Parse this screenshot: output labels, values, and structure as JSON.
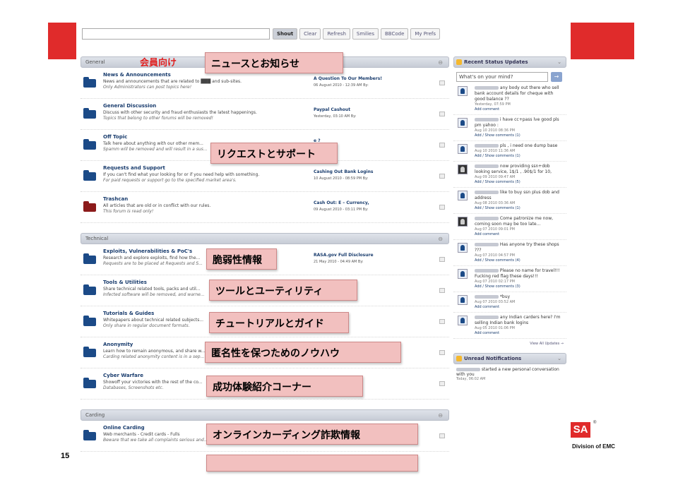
{
  "slide": {
    "page_number": "15",
    "logo_text": "SA",
    "logo_tm": "®",
    "division_text": "Division of EMC"
  },
  "shoutbox": {
    "buttons": [
      "Shout",
      "Clear",
      "Refresh",
      "Smilies",
      "BBCode",
      "My Prefs"
    ]
  },
  "categories": {
    "general": "General",
    "technical": "Technical",
    "carding": "Carding"
  },
  "member_label": "会員向け",
  "forums": [
    {
      "title": "News & Announcements",
      "desc": "News and announcements that are related to ███ and sub-sites.",
      "note": "Only Administrators can post topics here!",
      "last_title": "A Question To Our Members!",
      "last_date": "06 August 2010 - 12:39 AM By:"
    },
    {
      "title": "General Discussion",
      "desc": "Discuss with other security and fraud enthusiasts the latest happenings.",
      "note": "Topics that belong to other forums will be removed!",
      "last_title": "Paypal Cashout",
      "last_date": "Yesterday, 03:10 AM By:"
    },
    {
      "title": "Off Topic",
      "desc": "Talk here about anything with our other mem...",
      "note": "Spamm will be removed and will result in a sus...",
      "last_title": "e ?",
      "last_date": "04:51 PM By:"
    },
    {
      "title": "Requests and Support",
      "desc": "If you can't find what your looking for or if you need help with something.",
      "note": "For paid requests or support go to the specified market area's.",
      "last_title": "Cashing Out Bank Logins",
      "last_date": "10 August 2010 - 08:59 PM By:"
    },
    {
      "title": "Trashcan",
      "desc": "All articles that are old or in conflict with our rules.",
      "note": "This forum is read only!",
      "last_title": "Cash Out: E – Currency,",
      "last_date": "09 August 2010 - 03:11 PM By:"
    },
    {
      "title": "Exploits, Vulnerabilities & PoC's",
      "desc": "Research and explore exploits, find how the...",
      "note": "Requests are to be placed at Requests and S...",
      "last_title": "RASA.gov Full Disclosure",
      "last_date": "21 May 2010 - 04:49 AM By:"
    },
    {
      "title": "Tools & Utilities",
      "desc": "Share technical related tools, packs and util...",
      "note": "Infected software will be removed, and warne...",
      "last_title": "Password ...",
      "last_date": "2 PM By:"
    },
    {
      "title": "Tutorials & Guides",
      "desc": "Whitepapers about technical related subjects...",
      "note": "Only share in regular document formats.",
      "last_title": "ssing",
      "last_date": "23 AM By:"
    },
    {
      "title": "Anonymity",
      "desc": "Learn how to remain anonymous, and share w...",
      "note": "Carding related anonymity content is in a sep...",
      "last_title": "",
      "last_date": ""
    },
    {
      "title": "Cyber Warfare",
      "desc": "Showoff your victories with the rest of the co...",
      "note": "Databases, Screenshots etc.",
      "last_title": "rd",
      "last_date": "AM By:"
    },
    {
      "title": "Online Carding",
      "desc": "Web merchants - Credit cards - Fulls",
      "note": "Beware that we take all complaints serious and...",
      "last_title": "",
      "last_date": ""
    }
  ],
  "callouts": [
    "ニュースとお知らせ",
    "リクエストとサポート",
    "脆弱性情報",
    "ツールとユーティリティ",
    "チュートリアルとガイド",
    "匿名性を保つためのノウハウ",
    "成功体験紹介コーナー",
    "オンラインカーディング詐欺情報"
  ],
  "sidebar": {
    "title": "Recent Status Updates",
    "mind_placeholder": "What's on your mind?",
    "mind_button": "→",
    "statuses": [
      {
        "text": "any body out there who sell bank account details for cheque with good balance ??",
        "date": "Yesterday, 07:59 PM",
        "links": "Add comment",
        "dark": false
      },
      {
        "text": "i have cc+pass lve good pls pm yahoo :",
        "date": "Aug 10 2010 08:36 PM",
        "links": "Add / Show comments (1)",
        "dark": false
      },
      {
        "text": "pls , i need one dump base",
        "date": "Aug 10 2010 11:36 AM",
        "links": "Add / Show comments (1)",
        "dark": false
      },
      {
        "text": "now providing ssn+dob looking service, 1$/1 , .90$/1 for 10,",
        "date": "Aug 09 2010 09:47 AM",
        "links": "Add / Show comments (5)",
        "dark": true
      },
      {
        "text": "like to buy ssn plus dob and address",
        "date": "Aug 08 2010 03:36 AM",
        "links": "Add / Show comments (1)",
        "dark": false
      },
      {
        "text": "Come patronize me now, coming soon may be too late...",
        "date": "Aug 07 2010 09:01 PM",
        "links": "Add comment",
        "dark": true
      },
      {
        "text": "Has anyone try these shops ???",
        "date": "Aug 07 2010 04:57 PM",
        "links": "Add / Show comments (4)",
        "dark": false
      },
      {
        "text": "Please no name for travel!!! Fucking red flag these days!!!",
        "date": "Aug 07 2010 02:17 PM",
        "links": "Add / Show comments (3)",
        "dark": false
      },
      {
        "text": "*buy",
        "date": "Aug 07 2010 03:52 AM",
        "links": "Add comment",
        "dark": false
      },
      {
        "text": "any Indian carders here? I'm selling Indian bank logins",
        "date": "Aug 05 2010 01:06 PM",
        "links": "Add comment",
        "dark": false
      }
    ],
    "view_all": "View All Updates →",
    "unread_title": "Unread Notifications",
    "unread_text": "started a new personal conversation with you",
    "unread_date": "Today, 06:02 AM"
  }
}
